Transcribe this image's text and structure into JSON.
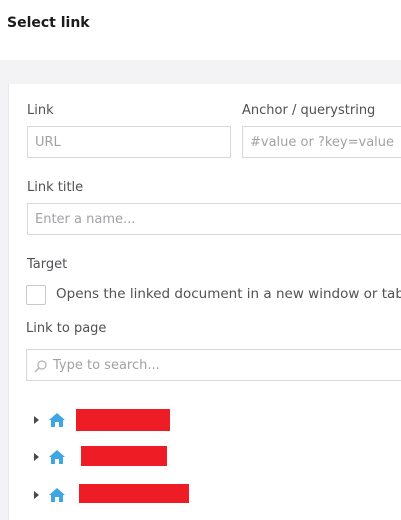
{
  "header": {
    "title": "Select link"
  },
  "form": {
    "link": {
      "label": "Link",
      "placeholder": "URL"
    },
    "anchor": {
      "label": "Anchor / querystring",
      "placeholder": "#value or ?key=value"
    },
    "link_title": {
      "label": "Link title",
      "placeholder": "Enter a name..."
    },
    "target": {
      "label": "Target",
      "checkbox_label": "Opens the linked document in a new window or tab"
    },
    "link_to_page": {
      "label": "Link to page",
      "search_placeholder": "Type to search..."
    }
  },
  "tree": {
    "items": [
      {
        "icon": "home-icon",
        "label": ""
      },
      {
        "icon": "home-icon",
        "label": ""
      },
      {
        "icon": "home-icon",
        "label": ""
      }
    ]
  },
  "colors": {
    "redaction": "#ee1c25",
    "home_icon": "#3fa6e6"
  }
}
